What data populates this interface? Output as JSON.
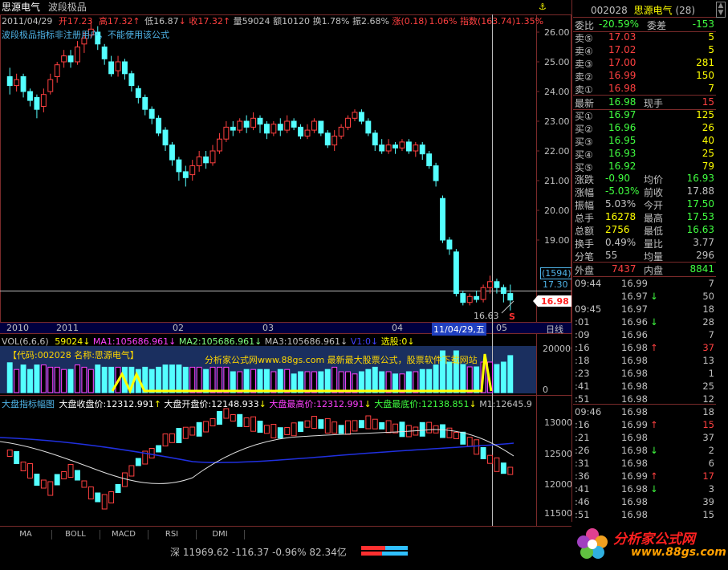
{
  "header": {
    "stock_name": "思源电气",
    "formula_name": "波段极品",
    "date": "2011/04/29",
    "open_label": "开",
    "open": "17.23",
    "high_label": "高",
    "high": "17.32",
    "low_label": "低",
    "low": "16.87",
    "close_label": "收",
    "close": "17.32",
    "vol_label": "量",
    "vol": "59024",
    "amt_label": "额",
    "amt": "10120",
    "turn_label": "换",
    "turn": "1.78%",
    "amp_label": "振",
    "amp": "2.68%",
    "chg_label": "涨",
    "chg": "(0.18)",
    "chg_pct": "1.06%",
    "idx_label": "指数",
    "idx": "(163.74)",
    "idx_pct": "1.35%",
    "warning": "波段极品指标非注册用户，不能使用该公式"
  },
  "main_axis": {
    "labels": [
      "26.00",
      "25.00",
      "24.00",
      "23.00",
      "22.00",
      "21.00",
      "20.00",
      "19.00",
      "17.30"
    ],
    "last_price_tag": "16.98",
    "cursor_value": "(1594)",
    "low_tag": "16.63",
    "sell_mark": "S",
    "date_axis": [
      "2010",
      "2011",
      "02",
      "03",
      "04",
      "11/04/29,五",
      "05"
    ],
    "period": "日线"
  },
  "volume": {
    "header": "VOL(6,6,6)",
    "vol": "59024",
    "ma1": "MA1:105686.961",
    "ma2": "MA2:105686.961",
    "ma3": "MA3:105686.961",
    "v1": "V1:0",
    "pick": "选股:0",
    "banner": "【代码:002028 名称:思源电气】",
    "ad": "分析家公式网www.88gs.com 最新最大股票公式，股票软件下载网站",
    "axis_top": "200000",
    "axis_bottom": "0"
  },
  "index_panel": {
    "title": "大盘指标幅图",
    "close_label": "大盘收盘价:12312.991",
    "open_label": "大盘开盘价:12148.933",
    "high_label": "大盘最高价:12312.991",
    "low_label": "大盘最底价:12138.851",
    "m1": "M1:12645.9",
    "axis": [
      "13000",
      "12500",
      "12000",
      "11500"
    ]
  },
  "tabs": [
    "MA",
    "BOLL",
    "MACD",
    "RSI",
    "DMI"
  ],
  "status_bar": {
    "market": "深",
    "index": "11969.62",
    "change": "-116.37",
    "pct": "-0.96%",
    "amount": "82.34亿"
  },
  "quote_panel": {
    "code": "002028",
    "name": "思源电气",
    "badge": "(28)",
    "webi_label": "委比",
    "webi": "-20.59%",
    "weicha_label": "委差",
    "weicha": "-153",
    "asks": [
      {
        "label": "卖⑤",
        "price": "17.03",
        "vol": "5"
      },
      {
        "label": "卖④",
        "price": "17.02",
        "vol": "5"
      },
      {
        "label": "卖③",
        "price": "17.00",
        "vol": "281"
      },
      {
        "label": "卖②",
        "price": "16.99",
        "vol": "150"
      },
      {
        "label": "卖①",
        "price": "16.98",
        "vol": "7"
      }
    ],
    "last_label": "最新",
    "last": "16.98",
    "cur_label": "现手",
    "cur": "15",
    "bids": [
      {
        "label": "买①",
        "price": "16.97",
        "vol": "125"
      },
      {
        "label": "买②",
        "price": "16.96",
        "vol": "26"
      },
      {
        "label": "买③",
        "price": "16.95",
        "vol": "40"
      },
      {
        "label": "买④",
        "price": "16.93",
        "vol": "25"
      },
      {
        "label": "买⑤",
        "price": "16.92",
        "vol": "79"
      }
    ],
    "stats": [
      {
        "l1": "涨跌",
        "v1": "-0.90",
        "l2": "均价",
        "v2": "16.93"
      },
      {
        "l1": "涨幅",
        "v1": "-5.03%",
        "l2": "前收",
        "v2": "17.88"
      },
      {
        "l1": "振幅",
        "v1": "5.03%",
        "l2": "今开",
        "v2": "17.50"
      },
      {
        "l1": "总手",
        "v1": "16278",
        "l2": "最高",
        "v2": "17.53"
      },
      {
        "l1": "总额",
        "v1": "2756",
        "l2": "最低",
        "v2": "16.63"
      },
      {
        "l1": "换手",
        "v1": "0.49%",
        "l2": "量比",
        "v2": "3.77"
      },
      {
        "l1": "分笔",
        "v1": "55",
        "l2": "均量",
        "v2": "296"
      }
    ],
    "outer_label": "外盘",
    "outer": "7437",
    "inner_label": "内盘",
    "inner": "8841",
    "ticks1": [
      {
        "t": "09:44",
        "p": "16.99",
        "a": "",
        "v": "7"
      },
      {
        "t": "",
        "p": "16.97",
        "a": "↓",
        "v": "50"
      },
      {
        "t": "09:45",
        "p": "16.97",
        "a": "",
        "v": "18"
      },
      {
        "t": ":01",
        "p": "16.96",
        "a": "↓",
        "v": "28"
      },
      {
        "t": ":09",
        "p": "16.96",
        "a": "",
        "v": "7"
      },
      {
        "t": ":16",
        "p": "16.98",
        "a": "↑",
        "v": "37"
      },
      {
        "t": ":18",
        "p": "16.98",
        "a": "",
        "v": "13"
      },
      {
        "t": ":23",
        "p": "16.98",
        "a": "",
        "v": "1"
      },
      {
        "t": ":41",
        "p": "16.98",
        "a": "",
        "v": "25"
      },
      {
        "t": ":51",
        "p": "16.98",
        "a": "",
        "v": "12"
      }
    ],
    "ticks2": [
      {
        "t": "09:46",
        "p": "16.98",
        "a": "",
        "v": "18"
      },
      {
        "t": ":16",
        "p": "16.99",
        "a": "↑",
        "v": "15"
      },
      {
        "t": ":21",
        "p": "16.98",
        "a": "",
        "v": "37"
      },
      {
        "t": ":26",
        "p": "16.98",
        "a": "↓",
        "v": "2"
      },
      {
        "t": ":31",
        "p": "16.98",
        "a": "",
        "v": "6"
      },
      {
        "t": ":36",
        "p": "16.99",
        "a": "↑",
        "v": "17"
      },
      {
        "t": ":41",
        "p": "16.98",
        "a": "↓",
        "v": "3"
      },
      {
        "t": ":46",
        "p": "16.98",
        "a": "",
        "v": "39"
      },
      {
        "t": ":51",
        "p": "16.98",
        "a": "",
        "v": "15"
      }
    ]
  },
  "logo": {
    "text": "分析家公式网",
    "url": "www.88gs.com"
  },
  "chart_data": {
    "type": "candlestick",
    "title": "思源电气",
    "ylim": [
      16.5,
      26.3
    ],
    "candles": [
      [
        24.5,
        24.2,
        24.8,
        23.9
      ],
      [
        24.2,
        24.4,
        24.6,
        24.0
      ],
      [
        24.5,
        24.0,
        24.6,
        23.8
      ],
      [
        24.0,
        23.7,
        24.1,
        23.5
      ],
      [
        23.8,
        23.4,
        23.9,
        23.1
      ],
      [
        23.5,
        23.9,
        24.1,
        23.3
      ],
      [
        24.0,
        24.4,
        24.6,
        23.9
      ],
      [
        24.5,
        24.9,
        25.0,
        24.3
      ],
      [
        25.0,
        25.2,
        25.4,
        24.8
      ],
      [
        25.2,
        25.0,
        25.4,
        24.8
      ],
      [
        25.0,
        25.5,
        25.7,
        24.9
      ],
      [
        25.6,
        25.8,
        26.0,
        25.3
      ],
      [
        25.9,
        26.1,
        26.4,
        25.8
      ],
      [
        26.0,
        25.6,
        26.2,
        25.4
      ],
      [
        25.5,
        25.1,
        25.6,
        24.9
      ],
      [
        25.0,
        24.6,
        25.2,
        24.5
      ],
      [
        24.7,
        25.0,
        25.2,
        24.5
      ],
      [
        25.0,
        24.6,
        25.1,
        24.4
      ],
      [
        24.6,
        24.2,
        24.7,
        24.0
      ],
      [
        24.1,
        23.8,
        24.2,
        23.6
      ],
      [
        23.8,
        23.4,
        23.9,
        23.2
      ],
      [
        23.4,
        23.1,
        23.5,
        22.9
      ],
      [
        23.1,
        22.6,
        23.2,
        22.5
      ],
      [
        22.7,
        22.2,
        22.8,
        22.0
      ],
      [
        22.2,
        21.7,
        22.3,
        21.5
      ],
      [
        21.7,
        21.3,
        21.8,
        21.0
      ],
      [
        21.3,
        21.1,
        21.5,
        20.8
      ],
      [
        21.2,
        21.5,
        21.7,
        21.0
      ],
      [
        21.5,
        21.8,
        22.0,
        21.3
      ],
      [
        21.8,
        21.6,
        22.0,
        21.4
      ],
      [
        21.6,
        22.0,
        22.2,
        21.5
      ],
      [
        22.0,
        22.4,
        22.6,
        21.9
      ],
      [
        22.4,
        22.8,
        23.0,
        22.3
      ],
      [
        22.8,
        22.7,
        23.0,
        22.5
      ],
      [
        22.7,
        23.0,
        23.1,
        22.6
      ],
      [
        23.0,
        22.8,
        23.2,
        22.6
      ],
      [
        22.8,
        23.1,
        23.3,
        22.7
      ],
      [
        23.1,
        22.9,
        23.2,
        22.6
      ],
      [
        22.9,
        22.6,
        23.0,
        22.4
      ],
      [
        22.6,
        22.9,
        23.0,
        22.5
      ],
      [
        22.9,
        22.7,
        23.1,
        22.5
      ],
      [
        22.7,
        23.0,
        23.2,
        22.6
      ],
      [
        23.0,
        22.8,
        23.1,
        22.7
      ],
      [
        22.8,
        22.5,
        22.9,
        22.4
      ],
      [
        22.5,
        22.7,
        22.9,
        22.4
      ],
      [
        22.7,
        23.0,
        23.1,
        22.6
      ],
      [
        23.0,
        22.6,
        23.0,
        22.5
      ],
      [
        22.6,
        22.2,
        22.7,
        22.1
      ],
      [
        22.2,
        22.5,
        22.7,
        22.0
      ],
      [
        22.5,
        22.8,
        22.9,
        22.4
      ],
      [
        22.8,
        23.1,
        23.2,
        22.7
      ],
      [
        23.1,
        23.3,
        23.4,
        23.0
      ],
      [
        23.3,
        23.0,
        23.4,
        22.9
      ],
      [
        23.0,
        22.6,
        23.1,
        22.5
      ],
      [
        22.6,
        22.2,
        22.7,
        22.0
      ],
      [
        22.2,
        22.0,
        22.4,
        21.9
      ],
      [
        22.0,
        22.2,
        22.4,
        21.9
      ],
      [
        22.2,
        22.1,
        22.3,
        21.9
      ],
      [
        22.1,
        22.3,
        22.4,
        22.0
      ],
      [
        22.3,
        22.0,
        22.4,
        21.9
      ],
      [
        22.0,
        22.2,
        22.3,
        21.8
      ],
      [
        22.2,
        21.9,
        22.3,
        21.7
      ],
      [
        21.9,
        21.5,
        22.0,
        21.4
      ],
      [
        21.5,
        21.0,
        21.6,
        20.8
      ],
      [
        20.4,
        19.0,
        20.5,
        18.9
      ],
      [
        19.0,
        18.7,
        19.1,
        18.5
      ],
      [
        18.6,
        17.2,
        18.7,
        17.1
      ],
      [
        17.2,
        16.9,
        17.3,
        16.8
      ],
      [
        16.9,
        17.1,
        17.2,
        16.8
      ],
      [
        17.1,
        17.0,
        17.3,
        16.9
      ],
      [
        17.0,
        17.4,
        17.5,
        16.9
      ],
      [
        17.4,
        17.6,
        17.8,
        17.2
      ],
      [
        17.6,
        17.4,
        17.7,
        17.2
      ],
      [
        17.4,
        17.2,
        17.5,
        16.9
      ],
      [
        17.2,
        16.98,
        17.5,
        16.63
      ]
    ]
  }
}
